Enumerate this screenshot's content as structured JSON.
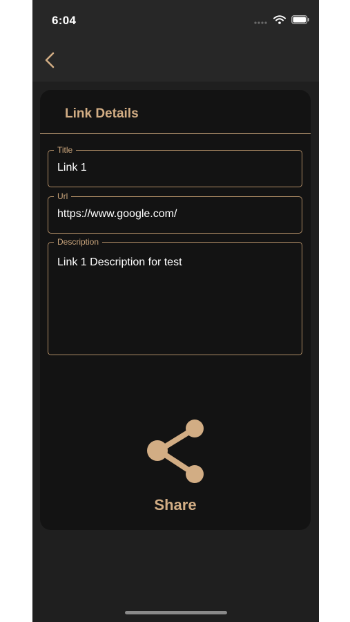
{
  "status_bar": {
    "time": "6:04"
  },
  "nav": {
    "back_icon": "chevron-left-icon"
  },
  "card": {
    "title": "Link Details",
    "fields": {
      "title": {
        "label": "Title",
        "value": "Link 1"
      },
      "url": {
        "label": "Url",
        "value": "https://www.google.com/"
      },
      "description": {
        "label": "Description",
        "value": "Link 1 Description for test"
      }
    },
    "share": {
      "icon": "share-icon",
      "label": "Share"
    }
  },
  "colors": {
    "accent": "#d2ad84",
    "background": "#272727",
    "card": "#131313",
    "text": "#ffffff"
  }
}
